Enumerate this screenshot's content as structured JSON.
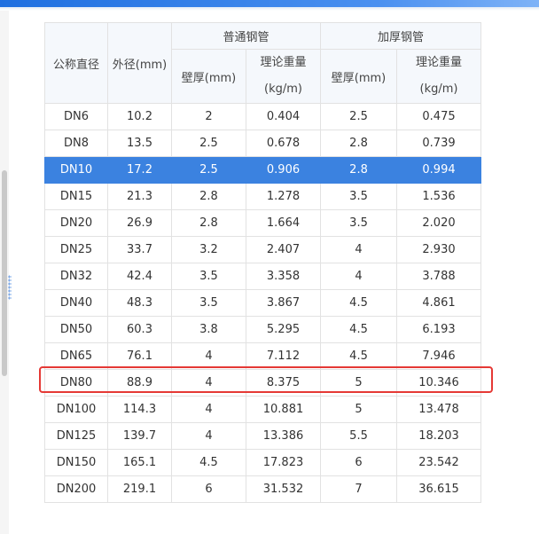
{
  "colors": {
    "selected_row": "#3b82e0",
    "highlight_border": "#e53935",
    "header_accent": "#1e6fe0"
  },
  "table": {
    "headers": {
      "nominal_diameter": "公称直径",
      "outer_diameter": "外径(mm)",
      "standard_group": "普通钢管",
      "thick_group": "加厚钢管",
      "wall_thickness": "壁厚(mm)",
      "theoretical_weight_line1": "理论重量",
      "theoretical_weight_line2": "(kg/m)"
    },
    "rows": [
      [
        "DN6",
        "10.2",
        "2",
        "0.404",
        "2.5",
        "0.475"
      ],
      [
        "DN8",
        "13.5",
        "2.5",
        "0.678",
        "2.8",
        "0.739"
      ],
      [
        "DN10",
        "17.2",
        "2.5",
        "0.906",
        "2.8",
        "0.994"
      ],
      [
        "DN15",
        "21.3",
        "2.8",
        "1.278",
        "3.5",
        "1.536"
      ],
      [
        "DN20",
        "26.9",
        "2.8",
        "1.664",
        "3.5",
        "2.020"
      ],
      [
        "DN25",
        "33.7",
        "3.2",
        "2.407",
        "4",
        "2.930"
      ],
      [
        "DN32",
        "42.4",
        "3.5",
        "3.358",
        "4",
        "3.788"
      ],
      [
        "DN40",
        "48.3",
        "3.5",
        "3.867",
        "4.5",
        "4.861"
      ],
      [
        "DN50",
        "60.3",
        "3.8",
        "5.295",
        "4.5",
        "6.193"
      ],
      [
        "DN65",
        "76.1",
        "4",
        "7.112",
        "4.5",
        "7.946"
      ],
      [
        "DN80",
        "88.9",
        "4",
        "8.375",
        "5",
        "10.346"
      ],
      [
        "DN100",
        "114.3",
        "4",
        "10.881",
        "5",
        "13.478"
      ],
      [
        "DN125",
        "139.7",
        "4",
        "13.386",
        "5.5",
        "18.203"
      ],
      [
        "DN150",
        "165.1",
        "4.5",
        "17.823",
        "6",
        "23.542"
      ],
      [
        "DN200",
        "219.1",
        "6",
        "31.532",
        "7",
        "36.615"
      ]
    ],
    "selected_row": "DN10",
    "highlighted_row": "DN80"
  }
}
